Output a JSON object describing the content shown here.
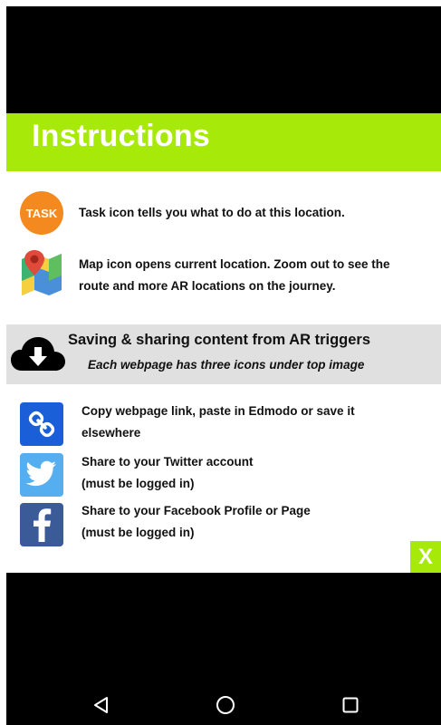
{
  "header": {
    "title": "Instructions"
  },
  "rows": [
    {
      "icon": "task-icon",
      "icon_text": "TASK",
      "line1": "Task icon tells you what to do at this location.",
      "line2": ""
    },
    {
      "icon": "map-icon",
      "line1": "Map icon opens current location. Zoom out to see the",
      "line2": "route and more AR locations on the journey."
    }
  ],
  "banner": {
    "icon": "cloud-download-icon",
    "title": "Saving & sharing content from AR triggers",
    "subtitle": "Each webpage has three icons under top image"
  },
  "share_items": [
    {
      "icon": "link-icon",
      "line1": "Copy webpage link, paste in Edmodo or save it",
      "line2": "elsewhere"
    },
    {
      "icon": "twitter-icon",
      "line1": "Share to your Twitter account",
      "line2": "(must be logged in)"
    },
    {
      "icon": "facebook-icon",
      "line1": "Share to your Facebook Profile or Page",
      "line2": "(must be logged in)"
    }
  ],
  "close": {
    "label": "X"
  },
  "colors": {
    "accent_green": "#a7ea0a",
    "task_orange": "#f48a1f",
    "link_blue": "#1a5fd8",
    "twitter_blue": "#55aef0",
    "facebook_blue": "#3b5a98",
    "banner_gray": "#e0e0e0"
  },
  "nav": {
    "back_icon": "back-triangle-icon",
    "home_icon": "home-circle-icon",
    "recents_icon": "recents-square-icon"
  }
}
